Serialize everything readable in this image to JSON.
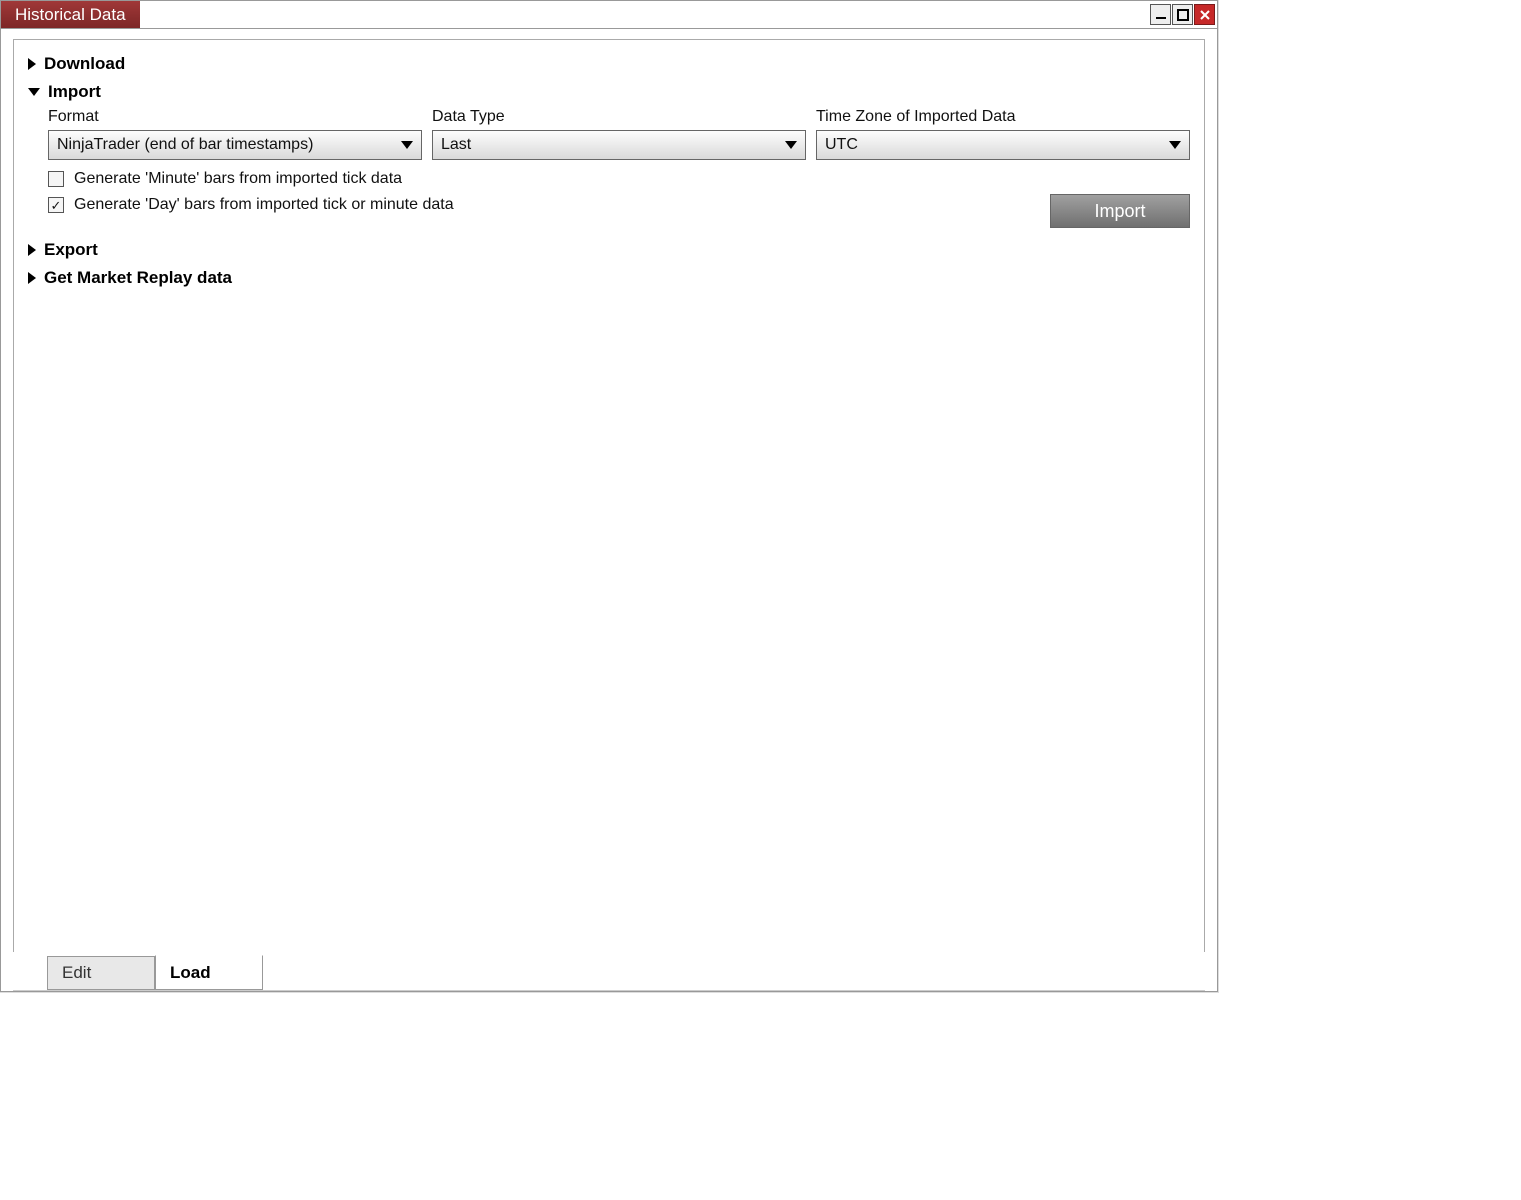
{
  "window": {
    "title": "Historical Data"
  },
  "sections": {
    "download": {
      "label": "Download",
      "expanded": false
    },
    "import": {
      "label": "Import",
      "expanded": true,
      "fields": {
        "format": {
          "label": "Format",
          "value": "NinjaTrader (end of bar timestamps)"
        },
        "dataType": {
          "label": "Data Type",
          "value": "Last"
        },
        "timezone": {
          "label": "Time Zone of Imported Data",
          "value": "UTC"
        }
      },
      "checkboxes": {
        "minute": {
          "label": "Generate 'Minute' bars from imported tick data",
          "checked": false
        },
        "day": {
          "label": "Generate 'Day' bars from imported tick or minute data",
          "checked": true
        }
      },
      "importButton": "Import"
    },
    "export": {
      "label": "Export",
      "expanded": false
    },
    "replay": {
      "label": "Get Market Replay data",
      "expanded": false
    }
  },
  "bottomTabs": {
    "edit": "Edit",
    "load": "Load"
  }
}
